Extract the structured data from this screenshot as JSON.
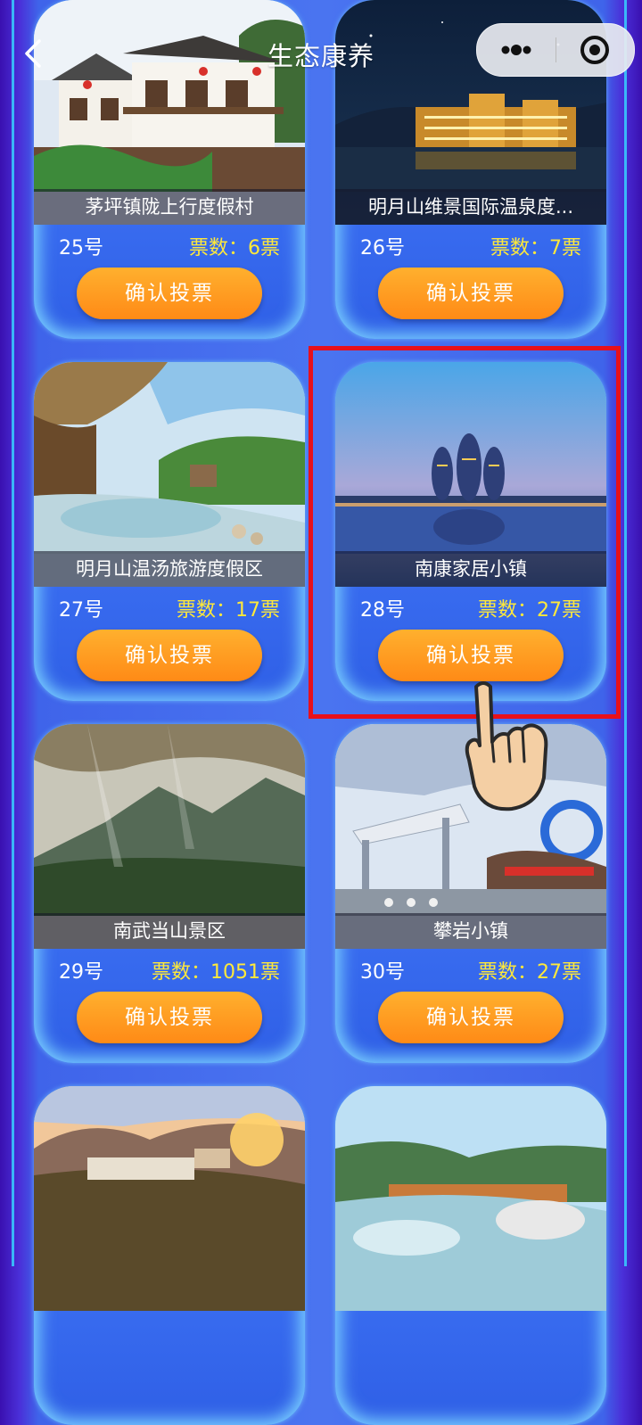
{
  "header": {
    "title": "生态康养"
  },
  "vote_button_label": "确认投票",
  "votes_prefix": "票数：",
  "cards": [
    {
      "name": "茅坪镇陇上行度假村",
      "number": "25号",
      "votes": "票数：6票"
    },
    {
      "name": "明月山维景国际温泉度...",
      "number": "26号",
      "votes": "票数：7票"
    },
    {
      "name": "明月山温汤旅游度假区",
      "number": "27号",
      "votes": "票数：17票"
    },
    {
      "name": "南康家居小镇",
      "number": "28号",
      "votes": "票数：27票"
    },
    {
      "name": "南武当山景区",
      "number": "29号",
      "votes": "票数：1051票"
    },
    {
      "name": "攀岩小镇",
      "number": "30号",
      "votes": "票数：27票"
    },
    {
      "name": "",
      "number": "",
      "votes": ""
    },
    {
      "name": "",
      "number": "",
      "votes": ""
    }
  ],
  "colors": {
    "accent": "#ff9a1f",
    "highlight": "#e8101b",
    "votes_text": "#ffe93a"
  }
}
